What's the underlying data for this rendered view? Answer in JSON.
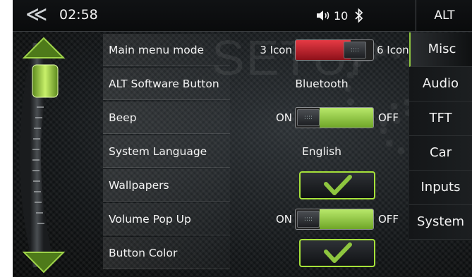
{
  "topbar": {
    "back_glyph": "≪",
    "time": "02:58",
    "volume_icon": "speaker-volume-icon",
    "volume_level": "10",
    "bluetooth_glyph": "✱",
    "alt_label": "ALT"
  },
  "watermark": "SETUP",
  "settings": {
    "main_menu_mode": {
      "label": "Main menu mode",
      "left": "3 Icon",
      "right": "6 Icon",
      "active": "6 Icon",
      "fill_color": "#cc1f2a"
    },
    "alt_software_button": {
      "label": "ALT Software Button",
      "value": "Bluetooth"
    },
    "beep": {
      "label": "Beep",
      "on": "ON",
      "off": "OFF",
      "state": "ON",
      "fill_color": "#8ec63f"
    },
    "system_language": {
      "label": "System Language",
      "value": "English"
    },
    "wallpapers": {
      "label": "Wallpapers",
      "control": "check-icon"
    },
    "volume_pop_up": {
      "label": "Volume Pop Up",
      "on": "ON",
      "off": "OFF",
      "state": "ON",
      "fill_color": "#8ec63f"
    },
    "button_color": {
      "label": "Button Color",
      "control": "check-icon"
    }
  },
  "tabs": [
    {
      "label": "Misc",
      "active": true
    },
    {
      "label": "Audio",
      "active": false
    },
    {
      "label": "TFT",
      "active": false
    },
    {
      "label": "Car",
      "active": false
    },
    {
      "label": "Inputs",
      "active": false
    },
    {
      "label": "System",
      "active": false
    }
  ],
  "colors": {
    "accent": "#8ec63f",
    "toggle_red": "#cc1f2a",
    "background": "#0b0d0e"
  }
}
